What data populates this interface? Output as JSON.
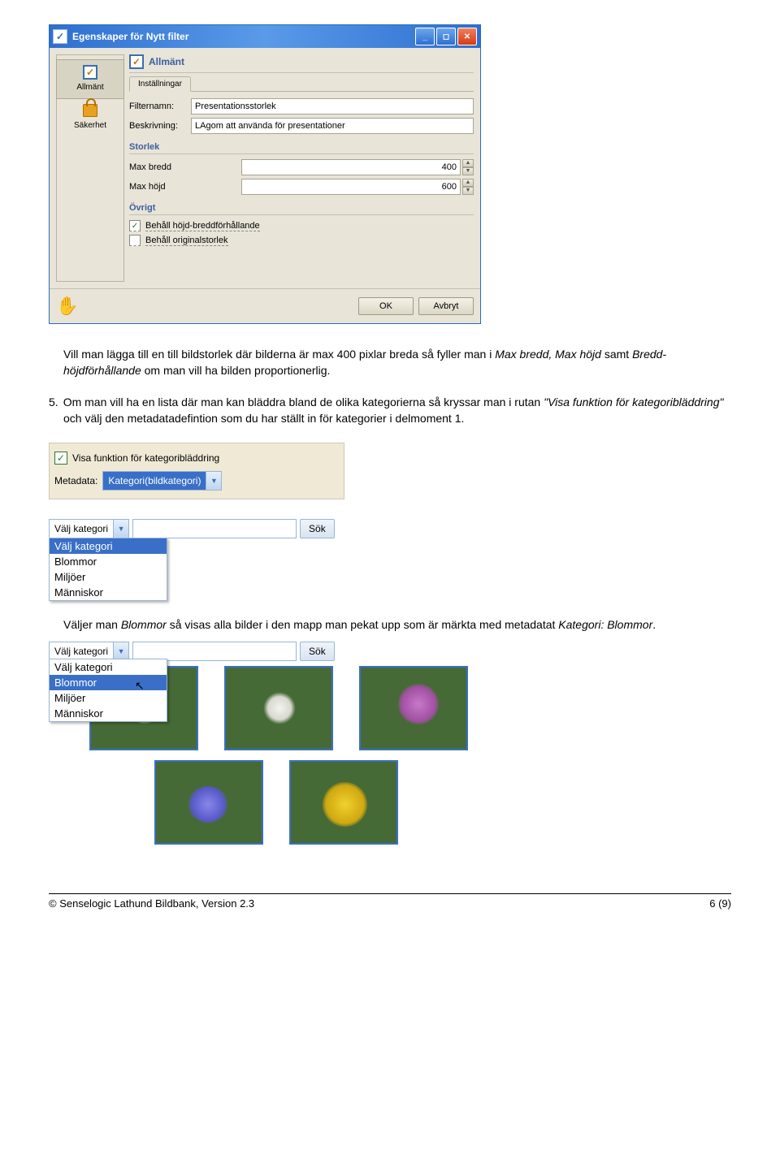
{
  "dialog": {
    "title": "Egenskaper för Nytt filter",
    "sidebar": {
      "allmant": "Allmänt",
      "sakerhet": "Säkerhet"
    },
    "header": "Allmänt",
    "tab": "Inställningar",
    "fields": {
      "filternamn_label": "Filternamn:",
      "filternamn_value": "Presentationsstorlek",
      "beskrivning_label": "Beskrivning:",
      "beskrivning_value": "LAgom att använda för presentationer"
    },
    "storlek": {
      "title": "Storlek",
      "max_bredd_label": "Max bredd",
      "max_bredd_value": "400",
      "max_hojd_label": "Max höjd",
      "max_hojd_value": "600"
    },
    "ovrigt": {
      "title": "Övrigt",
      "chk1": "Behåll höjd-breddförhållande",
      "chk2": "Behåll originalstorlek"
    },
    "buttons": {
      "ok": "OK",
      "avbryt": "Avbryt"
    }
  },
  "para1_a": "Vill man lägga till en till bildstorlek där bilderna är max 400 pixlar breda så fyller man i ",
  "para1_b": "Max bredd, Max höjd",
  "para1_c": " samt ",
  "para1_d": "Bredd-höjdförhållande",
  "para1_e": " om man vill ha bilden proportionerlig.",
  "para2_num": "5.",
  "para2_a": "Om man vill ha en lista där man kan bläddra bland de olika kategorierna så kryssar man i rutan ",
  "para2_b": "\"Visa funktion för kategoribläddring\"",
  "para2_c": " och välj den metadatadefintion som du har ställt in för kategorier i delmoment 1.",
  "meta_panel": {
    "checkbox_label": "Visa funktion för kategoribläddring",
    "metadata_label": "Metadata:",
    "metadata_value": "Kategori(bildkategori)"
  },
  "search1": {
    "select": "Välj kategori",
    "btn": "Sök",
    "options": [
      "Välj kategori",
      "Blommor",
      "Miljöer",
      "Människor"
    ],
    "selected_index": 0
  },
  "para3_a": "Väljer man ",
  "para3_b": "Blommor",
  "para3_c": " så visas alla bilder i den mapp man pekat upp som är märkta med metadatat ",
  "para3_d": "Kategori: Blommor",
  "para3_e": ".",
  "search2": {
    "select": "Välj kategori",
    "btn": "Sök",
    "options": [
      "Välj kategori",
      "Blommor",
      "Miljöer",
      "Människor"
    ],
    "selected_index": 1
  },
  "footer": {
    "left": "© Senselogic Lathund Bildbank, Version 2.3",
    "right": "6 (9)"
  }
}
